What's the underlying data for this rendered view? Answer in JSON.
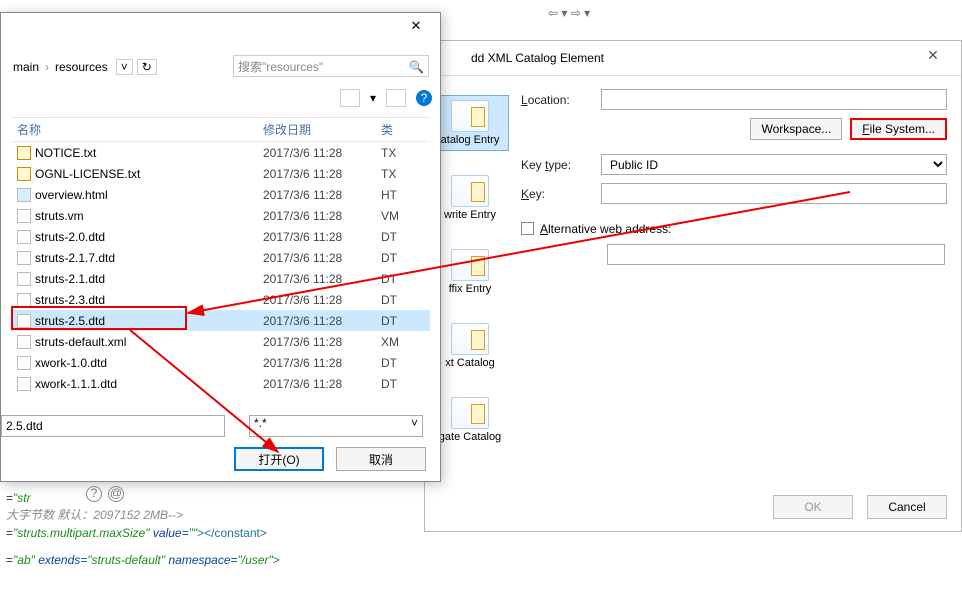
{
  "nav_arrows": "⇦ ▾  ⇨ ▾",
  "file_dialog": {
    "crumb1": "main",
    "crumb2": "resources",
    "search_placeholder": "搜索\"resources\"",
    "col_name": "名称",
    "col_date": "修改日期",
    "col_type": "类",
    "rows": [
      {
        "name": "NOTICE.txt",
        "date": "2017/3/6 11:28",
        "type": "TX",
        "ico": "txt"
      },
      {
        "name": "OGNL-LICENSE.txt",
        "date": "2017/3/6 11:28",
        "type": "TX",
        "ico": "txt"
      },
      {
        "name": "overview.html",
        "date": "2017/3/6 11:28",
        "type": "HT",
        "ico": "html"
      },
      {
        "name": "struts.vm",
        "date": "2017/3/6 11:28",
        "type": "VM",
        "ico": ""
      },
      {
        "name": "struts-2.0.dtd",
        "date": "2017/3/6 11:28",
        "type": "DT",
        "ico": ""
      },
      {
        "name": "struts-2.1.7.dtd",
        "date": "2017/3/6 11:28",
        "type": "DT",
        "ico": ""
      },
      {
        "name": "struts-2.1.dtd",
        "date": "2017/3/6 11:28",
        "type": "DT",
        "ico": ""
      },
      {
        "name": "struts-2.3.dtd",
        "date": "2017/3/6 11:28",
        "type": "DT",
        "ico": ""
      },
      {
        "name": "struts-2.5.dtd",
        "date": "2017/3/6 11:28",
        "type": "DT",
        "ico": "",
        "selected": true
      },
      {
        "name": "struts-default.xml",
        "date": "2017/3/6 11:28",
        "type": "XM",
        "ico": ""
      },
      {
        "name": "xwork-1.0.dtd",
        "date": "2017/3/6 11:28",
        "type": "DT",
        "ico": ""
      },
      {
        "name": "xwork-1.1.1.dtd",
        "date": "2017/3/6 11:28",
        "type": "DT",
        "ico": ""
      }
    ],
    "filename_value": "2.5.dtd",
    "filetype_value": "*.*",
    "open_btn": "打开(O)",
    "cancel_btn": "取消"
  },
  "xml_dialog": {
    "title": "dd XML Catalog Element",
    "catalog_items": [
      "atalog Entry",
      "write Entry",
      "ffix Entry",
      "xt Catalog",
      "gate Catalog"
    ],
    "location_label": "Location:",
    "workspace_btn": "Workspace...",
    "filesystem_btn": "File System...",
    "keytype_label": "Key type:",
    "keytype_value": "Public ID",
    "key_label": "Key:",
    "alt_label": "Alternative web address:",
    "ok_btn": "OK",
    "cancel_btn": "Cancel"
  },
  "code": {
    "line1_pre": "=",
    "line1_val": "\"str",
    "line2": "大字节数 默认：2097152  2MB-->",
    "line3_attr1": "\"struts.multipart.maxSize\"",
    "line3_mid": " value=",
    "line3_val2": "\"\"",
    "line3_end": "></constant>",
    "line4_pre": "=",
    "line4_v1": "\"ab\"",
    "line4_ext": " extends=",
    "line4_v2": "\"struts-default\"",
    "line4_ns": " namespace=",
    "line4_v3": "\"/user\"",
    "line4_end": ">"
  }
}
